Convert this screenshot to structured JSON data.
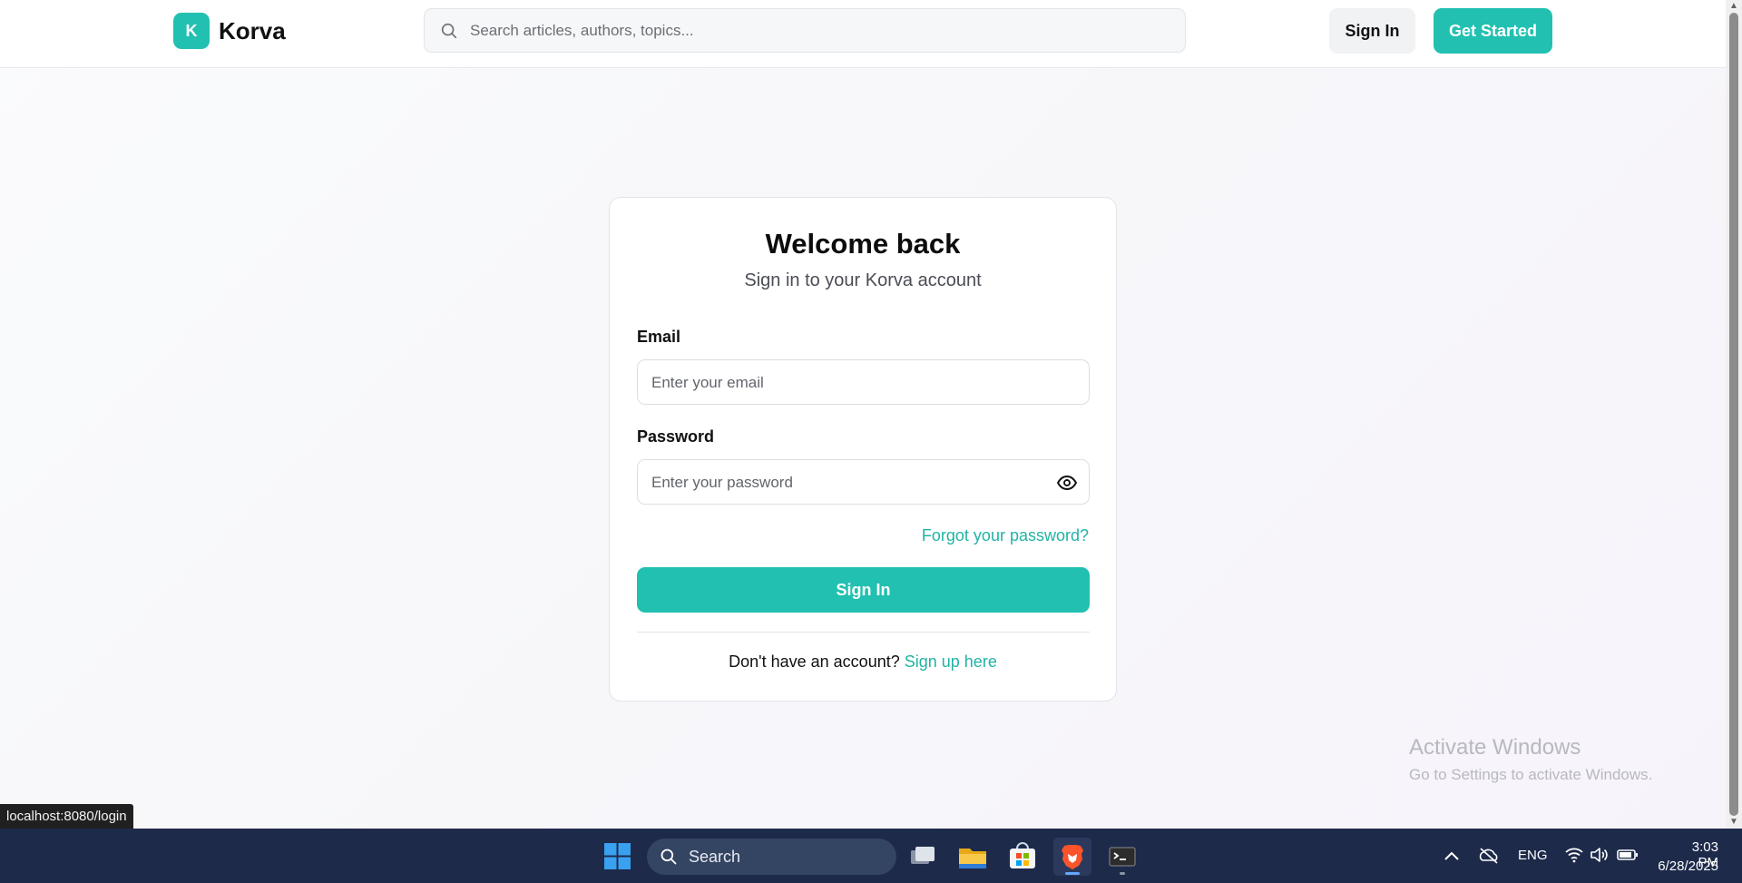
{
  "header": {
    "logo_letter": "K",
    "brand_name": "Korva",
    "search_placeholder": "Search articles, authors, topics...",
    "signin_label": "Sign In",
    "get_started_label": "Get Started"
  },
  "login": {
    "title": "Welcome back",
    "subtitle": "Sign in to your Korva account",
    "email_label": "Email",
    "email_placeholder": "Enter your email",
    "email_value": "",
    "password_label": "Password",
    "password_placeholder": "Enter your password",
    "password_value": "",
    "forgot_link": "Forgot your password?",
    "submit_label": "Sign In",
    "no_account_text": "Don't have an account?",
    "signup_link": "Sign up here"
  },
  "browser": {
    "status_url": "localhost:8080/login"
  },
  "watermark": {
    "title": "Activate Windows",
    "subtitle": "Go to Settings to activate Windows."
  },
  "taskbar": {
    "search_label": "Search",
    "apps": [
      "task-view",
      "file-explorer",
      "microsoft-store",
      "brave-browser",
      "terminal"
    ],
    "language": "ENG",
    "time": "3:03 PM",
    "date": "6/28/2025"
  },
  "colors": {
    "accent": "#22c0b0",
    "link": "#22b3a4",
    "taskbar": "#1d2a4a"
  }
}
